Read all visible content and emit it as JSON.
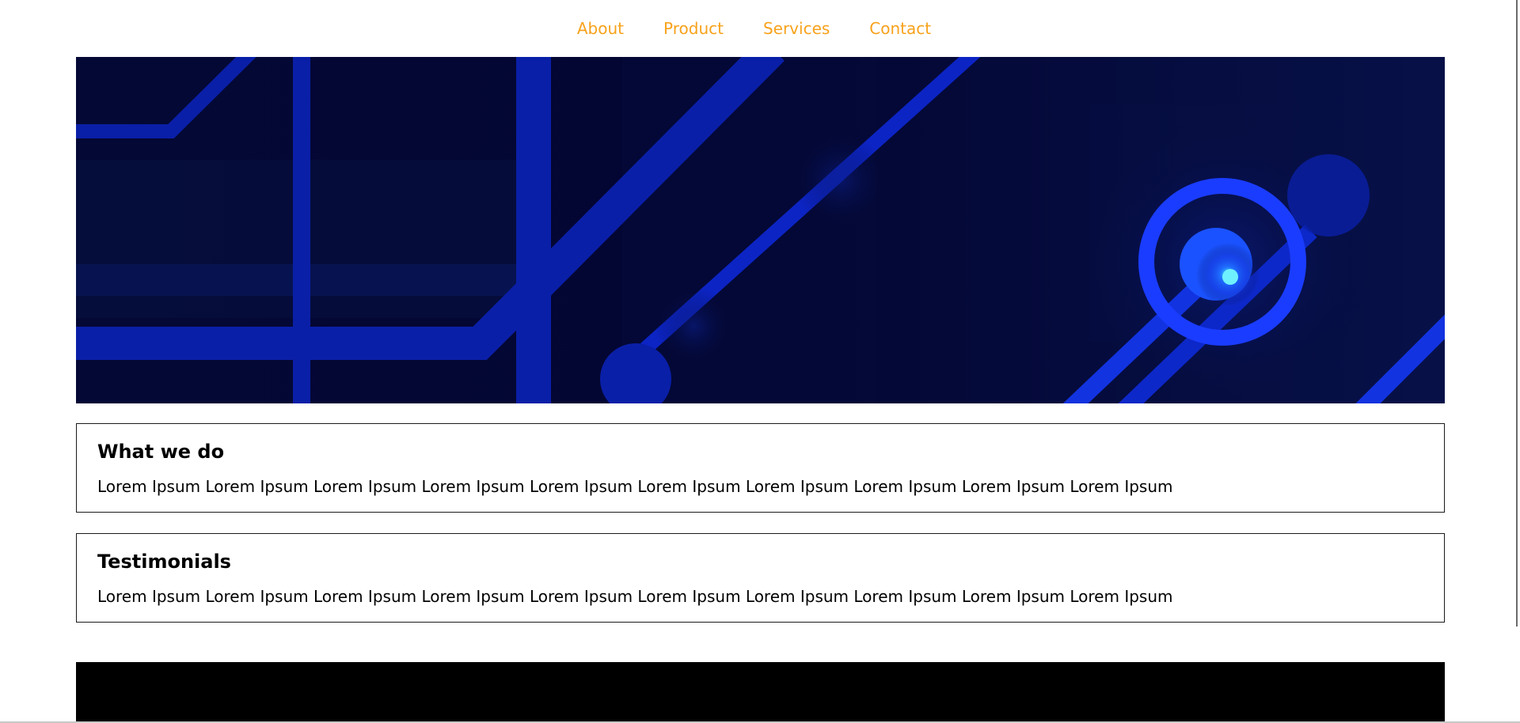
{
  "nav": {
    "items": [
      {
        "label": "About"
      },
      {
        "label": "Product"
      },
      {
        "label": "Services"
      },
      {
        "label": "Contact"
      }
    ],
    "link_color": "#f7a21b"
  },
  "hero": {
    "image": "circuit-board-banner",
    "colors": {
      "background": "#050a3a",
      "trace": "#0a1fa8",
      "glow": "#1f4dff",
      "core": "#3fe3ff"
    }
  },
  "sections": [
    {
      "title": "What we do",
      "text": "Lorem Ipsum Lorem Ipsum Lorem Ipsum Lorem Ipsum Lorem Ipsum Lorem Ipsum Lorem Ipsum Lorem Ipsum Lorem Ipsum Lorem Ipsum"
    },
    {
      "title": "Testimonials",
      "text": "Lorem Ipsum Lorem Ipsum Lorem Ipsum Lorem Ipsum Lorem Ipsum Lorem Ipsum Lorem Ipsum Lorem Ipsum Lorem Ipsum Lorem Ipsum"
    }
  ],
  "footer": {
    "color": "#000000"
  }
}
